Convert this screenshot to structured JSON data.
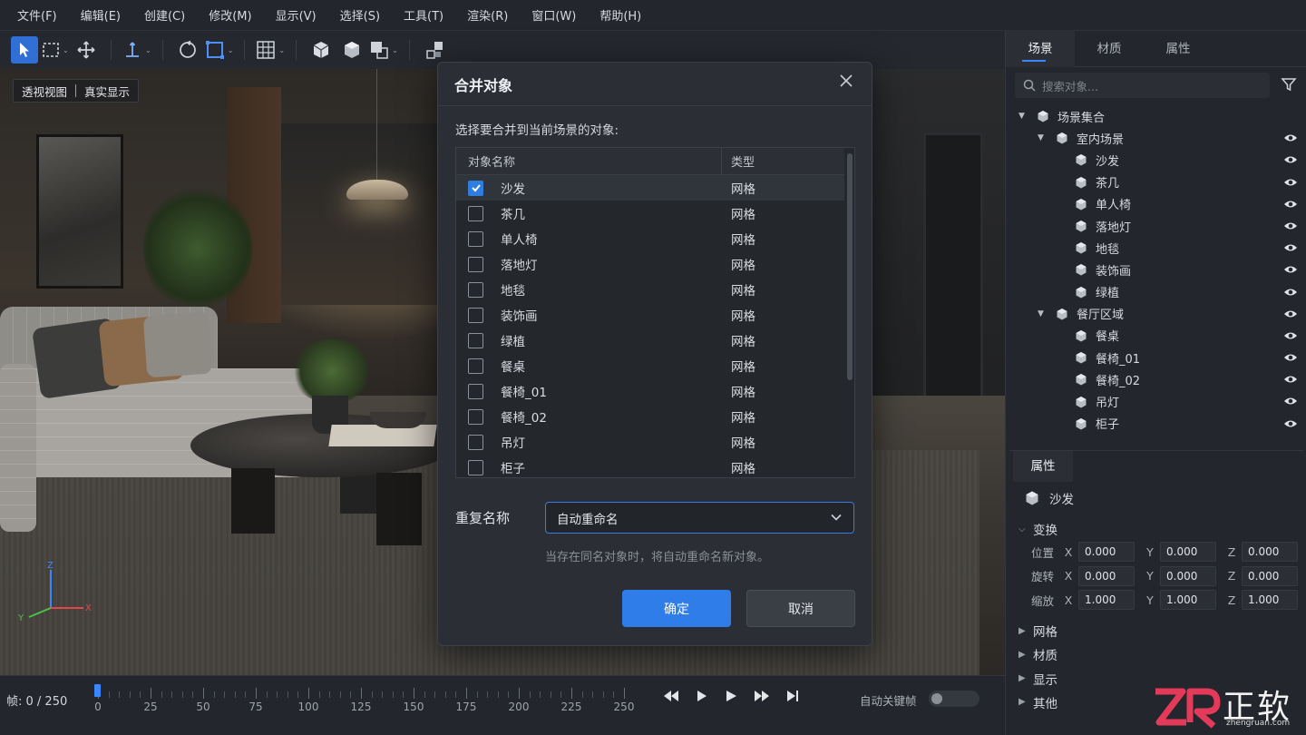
{
  "menu": [
    "文件(F)",
    "编辑(E)",
    "创建(C)",
    "修改(M)",
    "显示(V)",
    "选择(S)",
    "工具(T)",
    "渲染(R)",
    "窗口(W)",
    "帮助(H)"
  ],
  "viewport": {
    "view_mode": "透视视图",
    "display_mode": "真实显示"
  },
  "dialog": {
    "title": "合并对象",
    "prompt": "选择要合并到当前场景的对象:",
    "col_name": "对象名称",
    "col_type": "类型",
    "objects": [
      {
        "name": "沙发",
        "type": "网格",
        "checked": true
      },
      {
        "name": "茶几",
        "type": "网格",
        "checked": false
      },
      {
        "name": "单人椅",
        "type": "网格",
        "checked": false
      },
      {
        "name": "落地灯",
        "type": "网格",
        "checked": false
      },
      {
        "name": "地毯",
        "type": "网格",
        "checked": false
      },
      {
        "name": "装饰画",
        "type": "网格",
        "checked": false
      },
      {
        "name": "绿植",
        "type": "网格",
        "checked": false
      },
      {
        "name": "餐桌",
        "type": "网格",
        "checked": false
      },
      {
        "name": "餐椅_01",
        "type": "网格",
        "checked": false
      },
      {
        "name": "餐椅_02",
        "type": "网格",
        "checked": false
      },
      {
        "name": "吊灯",
        "type": "网格",
        "checked": false
      },
      {
        "name": "柜子",
        "type": "网格",
        "checked": false
      }
    ],
    "dup_label": "重复名称",
    "dup_value": "自动重命名",
    "hint": "当存在同名对象时，将自动重命名新对象。",
    "ok": "确定",
    "cancel": "取消"
  },
  "right_panel": {
    "tabs": [
      "场景",
      "材质",
      "属性"
    ],
    "search_placeholder": "搜索对象...",
    "tree": [
      {
        "label": "场景集合",
        "level": 0,
        "expandable": true,
        "eye": false
      },
      {
        "label": "室内场景",
        "level": 1,
        "expandable": true,
        "eye": true
      },
      {
        "label": "沙发",
        "level": 2,
        "expandable": false,
        "eye": true
      },
      {
        "label": "茶几",
        "level": 2,
        "expandable": false,
        "eye": true
      },
      {
        "label": "单人椅",
        "level": 2,
        "expandable": false,
        "eye": true
      },
      {
        "label": "落地灯",
        "level": 2,
        "expandable": false,
        "eye": true
      },
      {
        "label": "地毯",
        "level": 2,
        "expandable": false,
        "eye": true
      },
      {
        "label": "装饰画",
        "level": 2,
        "expandable": false,
        "eye": true
      },
      {
        "label": "绿植",
        "level": 2,
        "expandable": false,
        "eye": true
      },
      {
        "label": "餐厅区域",
        "level": 1,
        "expandable": true,
        "eye": true
      },
      {
        "label": "餐桌",
        "level": 2,
        "expandable": false,
        "eye": true
      },
      {
        "label": "餐椅_01",
        "level": 2,
        "expandable": false,
        "eye": true
      },
      {
        "label": "餐椅_02",
        "level": 2,
        "expandable": false,
        "eye": true
      },
      {
        "label": "吊灯",
        "level": 2,
        "expandable": false,
        "eye": true
      },
      {
        "label": "柜子",
        "level": 2,
        "expandable": false,
        "eye": true
      }
    ],
    "props_tab": "属性",
    "selected_object": "沙发",
    "transform_label": "变换",
    "rows": [
      {
        "label": "位置",
        "x": "0.000",
        "y": "0.000",
        "z": "0.000"
      },
      {
        "label": "旋转",
        "x": "0.000",
        "y": "0.000",
        "z": "0.000"
      },
      {
        "label": "缩放",
        "x": "1.000",
        "y": "1.000",
        "z": "1.000"
      }
    ],
    "axes": {
      "x": "X",
      "y": "Y",
      "z": "Z"
    },
    "sections": [
      "网格",
      "材质",
      "显示",
      "其他"
    ]
  },
  "timeline": {
    "frame_label": "帧: 0 / 250",
    "ticks": [
      "0",
      "25",
      "50",
      "75",
      "100",
      "125",
      "150",
      "175",
      "200",
      "225",
      "250"
    ],
    "autokey_label": "自动关键帧"
  },
  "gizmo": {
    "z": "Z",
    "x": "X",
    "y": "Y"
  },
  "watermark": {
    "text": "正软",
    "url": "zhengruan.com",
    "logo": "ZR"
  }
}
